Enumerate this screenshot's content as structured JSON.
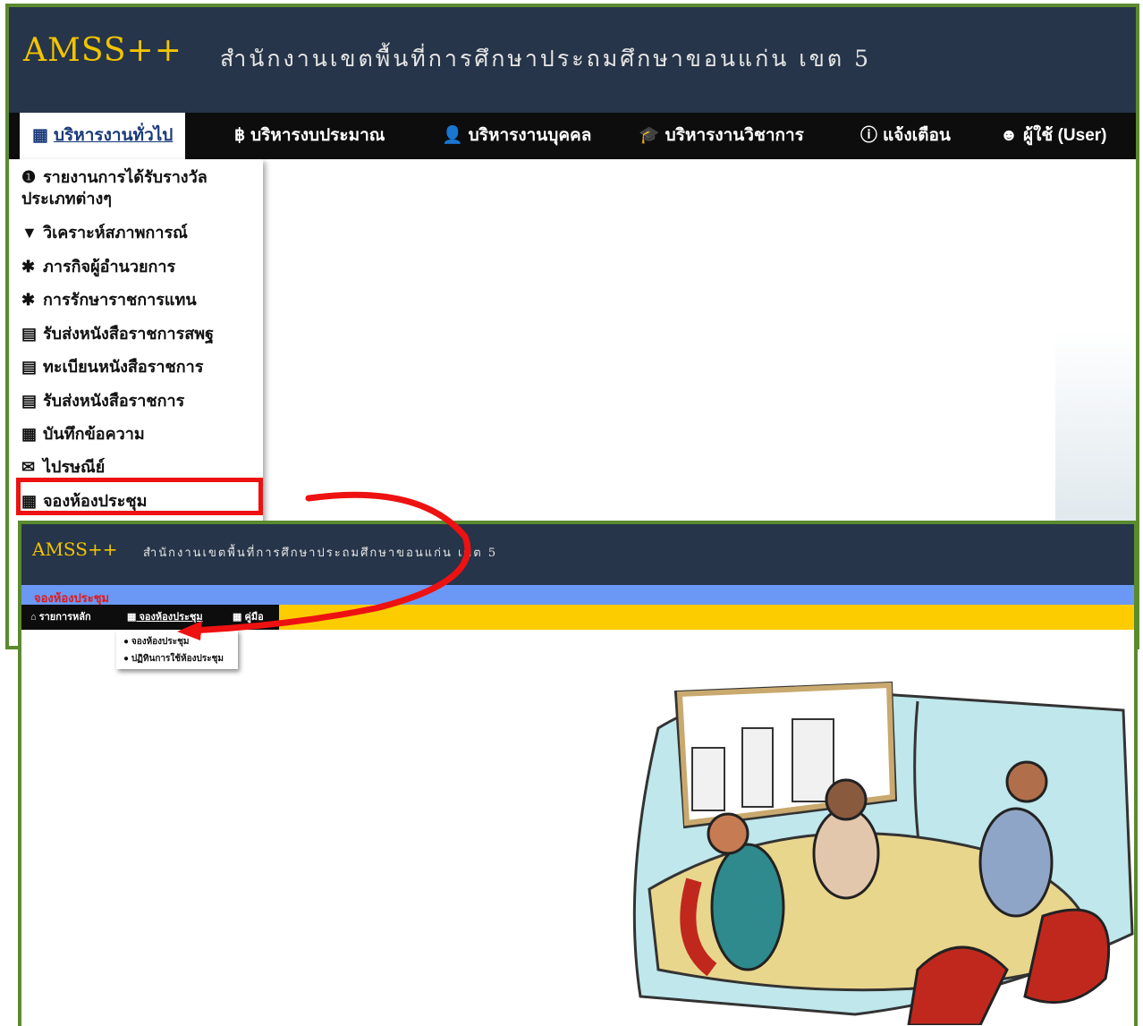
{
  "shot1": {
    "brand": "AMSS++",
    "org_name": "สำนักงานเขตพื้นที่การศึกษาประถมศึกษาขอนแก่น เขต 5",
    "nav": [
      {
        "icon": "grid-icon",
        "glyph": "▦",
        "label": "บริหารงานทั่วไป"
      },
      {
        "icon": "baht-icon",
        "glyph": "฿",
        "label": "บริหารงบประมาณ"
      },
      {
        "icon": "user-icon",
        "glyph": "👤",
        "label": "บริหารงานบุคคล"
      },
      {
        "icon": "graduation-cap-icon",
        "glyph": "🎓",
        "label": "บริหารงานวิชาการ"
      },
      {
        "icon": "info-icon",
        "glyph": "ⓘ",
        "label": "แจ้งเตือน"
      },
      {
        "icon": "user-circle-icon",
        "glyph": "☻",
        "label": "ผู้ใช้ (User)"
      }
    ],
    "menu": [
      {
        "icon": "info-icon",
        "glyph": "❶",
        "label_line1": "รายงานการได้รับรางวัล",
        "label_line2": "ประเภทต่างๆ"
      },
      {
        "icon": "filter-icon",
        "glyph": "▼",
        "label": "วิเคราะห์สภาพการณ์"
      },
      {
        "icon": "asterisk-icon",
        "glyph": "✱",
        "label": "ภารกิจผู้อำนวยการ"
      },
      {
        "icon": "asterisk-icon",
        "glyph": "✱",
        "label": "การรักษาราชการแทน"
      },
      {
        "icon": "book-icon",
        "glyph": "▤",
        "label": "รับส่งหนังสือราชการสพฐ"
      },
      {
        "icon": "book-icon",
        "glyph": "▤",
        "label": "ทะเบียนหนังสือราชการ"
      },
      {
        "icon": "book-icon",
        "glyph": "▤",
        "label": "รับส่งหนังสือราชการ"
      },
      {
        "icon": "grid-icon",
        "glyph": "▦",
        "label": "บันทึกข้อความ"
      },
      {
        "icon": "envelope-icon",
        "glyph": "✉",
        "label": "ไปรษณีย์"
      },
      {
        "icon": "grid-icon",
        "glyph": "▦",
        "label": "จองห้องประชุม"
      }
    ]
  },
  "shot2": {
    "brand": "AMSS++",
    "org_name": "สำนักงานเขตพื้นที่การศึกษาประถมศึกษาขอนแก่น เขต 5",
    "page_title": "จองห้องประชุม",
    "nav": [
      {
        "icon": "home-icon",
        "glyph": "⌂",
        "label": "รายการหลัก"
      },
      {
        "icon": "grid-icon",
        "glyph": "▦",
        "label": "จองห้องประชุม"
      },
      {
        "icon": "grid-icon",
        "glyph": "▦",
        "label": "คู่มือ"
      }
    ],
    "dropdown": [
      {
        "icon": "circle-arrow-icon",
        "glyph": "●",
        "label": "จองห้องประชุม"
      },
      {
        "icon": "circle-arrow-icon",
        "glyph": "●",
        "label": "ปฏิทินการใช้ห้องประชุม"
      }
    ]
  },
  "colors": {
    "header_bg": "#263549",
    "brand_gold": "#f2c400",
    "nav_bg": "#0d0d0d",
    "frame_green": "#5b8a2f",
    "highlight_red": "#ee1111",
    "band_blue": "#6a98f4",
    "band_yellow": "#fccc00"
  }
}
